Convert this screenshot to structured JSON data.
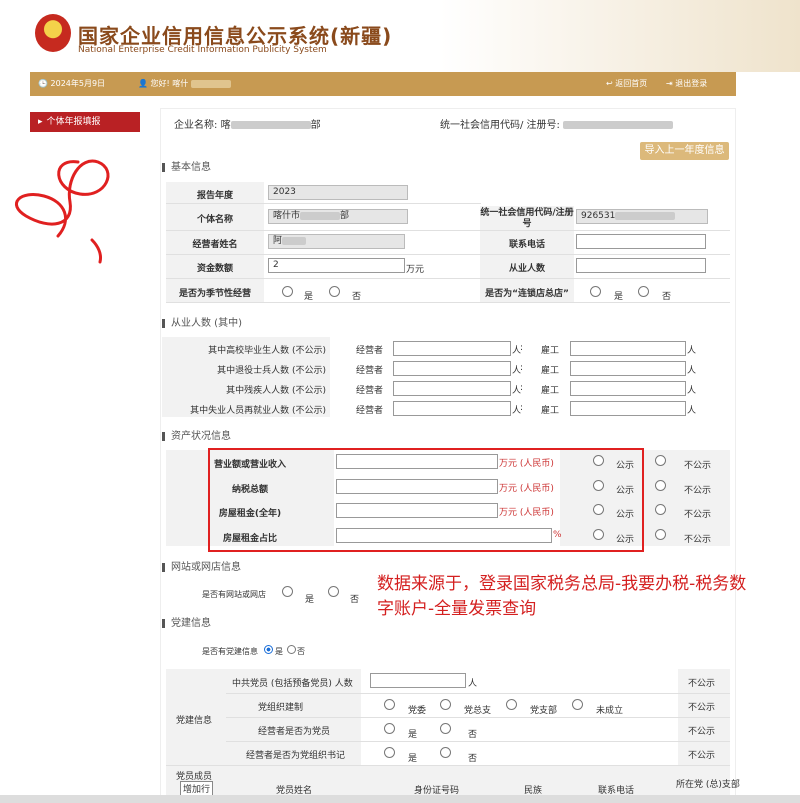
{
  "header": {
    "title_cn": "国家企业信用信息公示系统(新疆)",
    "title_en": "National Enterprise Credit Information Publicity System"
  },
  "navbar": {
    "date": "2024年5月9日",
    "greeting": "您好! 喀什",
    "home": "返回首页",
    "logout": "退出登录"
  },
  "sidebar": {
    "item": "个体年报填报"
  },
  "company": {
    "name_label": "企业名称:",
    "name_value": "喀",
    "name_suffix": "部",
    "credit_label": "统一社会信用代码/ 注册号:"
  },
  "import_button": "导入上一年度信息",
  "basic": {
    "title": "基本信息",
    "report_year_label": "报告年度",
    "report_year": "2023",
    "indiv_name_label": "个体名称",
    "indiv_name": "喀什市",
    "indiv_name_suffix": "部",
    "credit_label": "统一社会信用代码/注册号",
    "credit_value": "926531",
    "operator_label": "经营者姓名",
    "operator_value": "阿",
    "phone_label": "联系电话",
    "capital_label": "资金数额",
    "capital_value": "2",
    "capital_unit": "万元",
    "employees_label": "从业人数",
    "seasonal_label": "是否为季节性经营",
    "chain_label": "是否为“连锁店总店”",
    "yes": "是",
    "no": "否"
  },
  "employees": {
    "title": "从业人数 (其中)",
    "rows": [
      "其中高校毕业生人数 (不公示)",
      "其中退役士兵人数 (不公示)",
      "其中残疾人人数 (不公示)",
      "其中失业人员再就业人数 (不公示)"
    ],
    "operator": "经营者",
    "employee": "雇工",
    "unit": "人",
    "colon": ":"
  },
  "assets": {
    "title": "资产状况信息",
    "rows": [
      {
        "label": "营业额或营业收入",
        "unit": "万元 (人民币)"
      },
      {
        "label": "纳税总额",
        "unit": "万元 (人民币)"
      },
      {
        "label": "房屋租金(全年)",
        "unit": "万元 (人民币)"
      },
      {
        "label": "房屋租金占比",
        "unit": "%"
      }
    ],
    "public": "公示",
    "not_public": "不公示"
  },
  "website": {
    "title": "网站或网店信息",
    "has_label": "是否有网站或网店",
    "yes": "是",
    "no": "否"
  },
  "party": {
    "title": "党建信息",
    "has_label": "是否有党建信息",
    "yes": "是",
    "no": "否",
    "side_label": "党建信息",
    "members_label": "中共党员 (包括预备党员) 人数",
    "members_unit": "人",
    "not_public": "不公示",
    "org_label": "党组织建制",
    "org_options": [
      "党委",
      "党总支",
      "党支部",
      "未成立"
    ],
    "is_member_label": "经营者是否为党员",
    "is_secretary_label": "经营者是否为党组织书记"
  },
  "members_table": {
    "side_label": "党员成员",
    "add_button": "增加行",
    "cols": [
      "党员姓名",
      "身份证号码",
      "民族",
      "联系电话",
      "所在党 (总)支部"
    ]
  },
  "annotation": "数据来源于，登录国家税务总局-我要办税-税务数字账户-全量发票查询"
}
